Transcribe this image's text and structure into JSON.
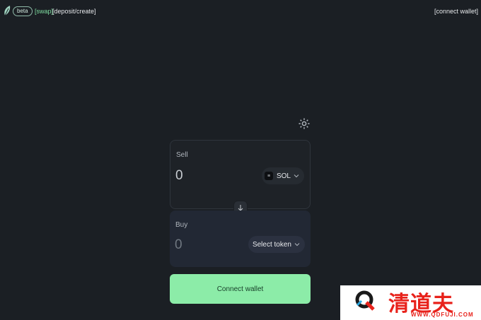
{
  "header": {
    "beta_label": "beta",
    "nav_swap": "[swap]",
    "nav_deposit": "[deposit/create]",
    "connect_wallet": "[connect wallet]"
  },
  "sell": {
    "label": "Sell",
    "amount": "0",
    "token_symbol": "SOL",
    "token_icon_glyph": "≡"
  },
  "buy": {
    "label": "Buy",
    "amount": "0",
    "select_label": "Select token"
  },
  "actions": {
    "connect_wallet": "Connect wallet"
  },
  "watermark": {
    "text": "清道夫",
    "url": "WWW.QDFUJI.COM"
  },
  "colors": {
    "background": "#1b1f24",
    "accent_green": "#8ceca8",
    "nav_active": "#7fdca0",
    "watermark_red": "#e8221b"
  },
  "icons": {
    "logo": "leaf-logo-icon",
    "settings": "gear-icon",
    "swap_direction": "arrow-down-icon",
    "dropdown": "chevron-down-icon"
  }
}
